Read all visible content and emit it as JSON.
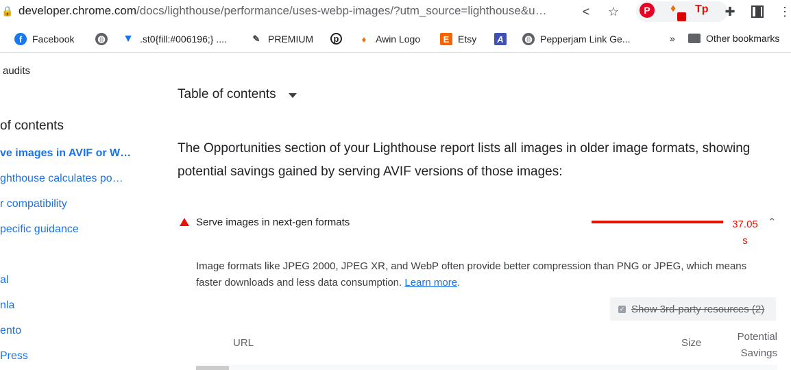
{
  "browser": {
    "url_host": "developer.chrome.com",
    "url_path": "/docs/lighthouse/performance/uses-webp-images/?utm_source=lighthouse&u…",
    "bookmarks": [
      {
        "label": "Facebook",
        "icon": "facebook-icon"
      },
      {
        "label": "",
        "icon": "globe-icon"
      },
      {
        "label": ".st0{fill:#006196;} ....",
        "icon": "v-logo-icon"
      },
      {
        "label": "PREMIUM",
        "icon": "pen-icon"
      },
      {
        "label": "",
        "icon": "p-logo-icon"
      },
      {
        "label": "Awin Logo",
        "icon": "flame-icon"
      },
      {
        "label": "Etsy",
        "icon": "etsy-icon"
      },
      {
        "label": "",
        "icon": "a-logo-icon"
      },
      {
        "label": "Pepperjam Link Ge...",
        "icon": "globe-icon"
      }
    ],
    "more_bookmarks": "»",
    "other_bookmarks": "Other bookmarks",
    "colors": {
      "link": "#1a73e8",
      "fail": "#eb0f00"
    }
  },
  "sidebar": {
    "back_link": "audits",
    "toc_heading": "of contents",
    "items": [
      {
        "label": "ve images in AVIF or W…",
        "bold": true
      },
      {
        "label": "ghthouse calculates po…"
      },
      {
        "label": "r compatibility"
      },
      {
        "label": "pecific guidance"
      }
    ],
    "stacks": [
      "al",
      "nla",
      "ento",
      "Press"
    ]
  },
  "main": {
    "toc_label": "Table of contents",
    "intro": "The Opportunities section of your Lighthouse report lists all images in older image formats, showing potential savings gained by serving AVIF versions of those images:",
    "audit": {
      "title": "Serve images in next-gen formats",
      "value": "37.05 s",
      "description_text": "Image formats like JPEG 2000, JPEG XR, and WebP often provide better compression than PNG or JPEG, which means faster downloads and less data consumption.",
      "learn_more": "Learn more",
      "third_party_label": "Show 3rd-party resources (2)",
      "columns": {
        "url": "URL",
        "size": "Size",
        "savings": "Potential Savings"
      }
    }
  }
}
